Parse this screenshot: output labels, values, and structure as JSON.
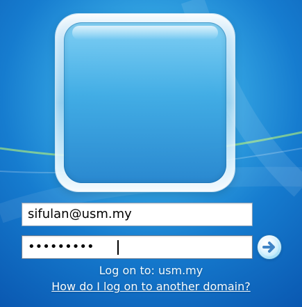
{
  "login": {
    "username_value": "sifulan@usm.my",
    "password_mask": "•••••••••",
    "logon_to_text": "Log on to: usm.my",
    "help_link_text": "How do I log on to another domain?"
  },
  "icons": {
    "submit": "right-arrow-icon",
    "avatar": "user-avatar"
  },
  "colors": {
    "background": "#167ccf",
    "frame": "#e7f6ff",
    "text": "#ffffff"
  }
}
